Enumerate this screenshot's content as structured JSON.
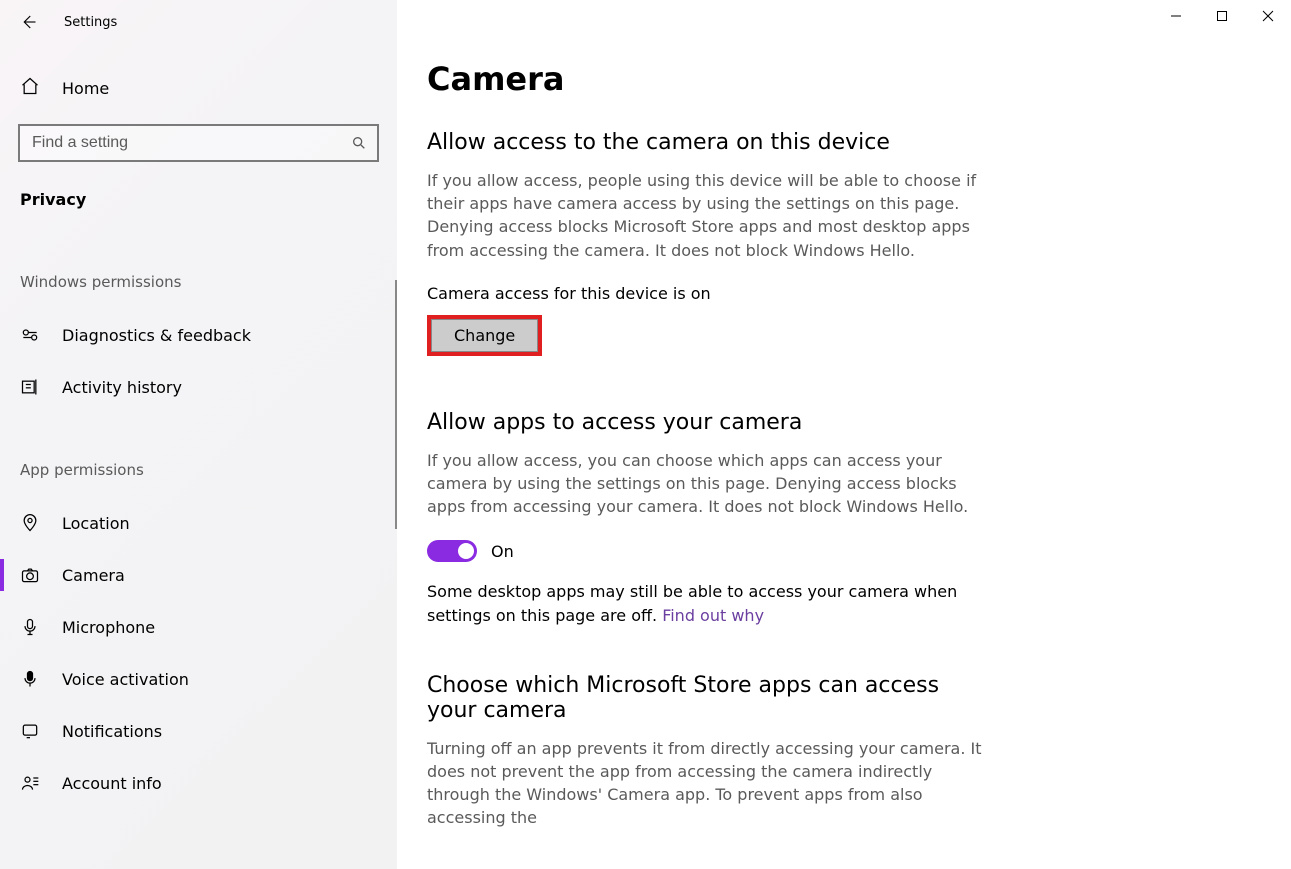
{
  "app_title": "Settings",
  "home_label": "Home",
  "search": {
    "placeholder": "Find a setting"
  },
  "current_section": "Privacy",
  "groups": {
    "windows_permissions": {
      "header": "Windows permissions",
      "items": [
        {
          "key": "diagnostics",
          "label": "Diagnostics & feedback"
        },
        {
          "key": "activity",
          "label": "Activity history"
        }
      ]
    },
    "app_permissions": {
      "header": "App permissions",
      "items": [
        {
          "key": "location",
          "label": "Location"
        },
        {
          "key": "camera",
          "label": "Camera",
          "active": true
        },
        {
          "key": "microphone",
          "label": "Microphone"
        },
        {
          "key": "voice",
          "label": "Voice activation"
        },
        {
          "key": "notifications",
          "label": "Notifications"
        },
        {
          "key": "account",
          "label": "Account info"
        }
      ]
    }
  },
  "page": {
    "title": "Camera",
    "allow_device": {
      "heading": "Allow access to the camera on this device",
      "body": "If you allow access, people using this device will be able to choose if their apps have camera access by using the settings on this page. Denying access blocks Microsoft Store apps and most desktop apps from accessing the camera. It does not block Windows Hello.",
      "status": "Camera access for this device is on",
      "change_label": "Change"
    },
    "allow_apps": {
      "heading": "Allow apps to access your camera",
      "body": "If you allow access, you can choose which apps can access your camera by using the settings on this page. Denying access blocks apps from accessing your camera. It does not block Windows Hello.",
      "toggle_state": "On",
      "desktop_note_prefix": "Some desktop apps may still be able to access your camera when settings on this page are off. ",
      "desktop_note_link": "Find out why"
    },
    "choose_apps": {
      "heading": "Choose which Microsoft Store apps can access your camera",
      "body": "Turning off an app prevents it from directly accessing your camera. It does not prevent the app from accessing the camera indirectly through the Windows' Camera app. To prevent apps from also accessing the"
    }
  }
}
